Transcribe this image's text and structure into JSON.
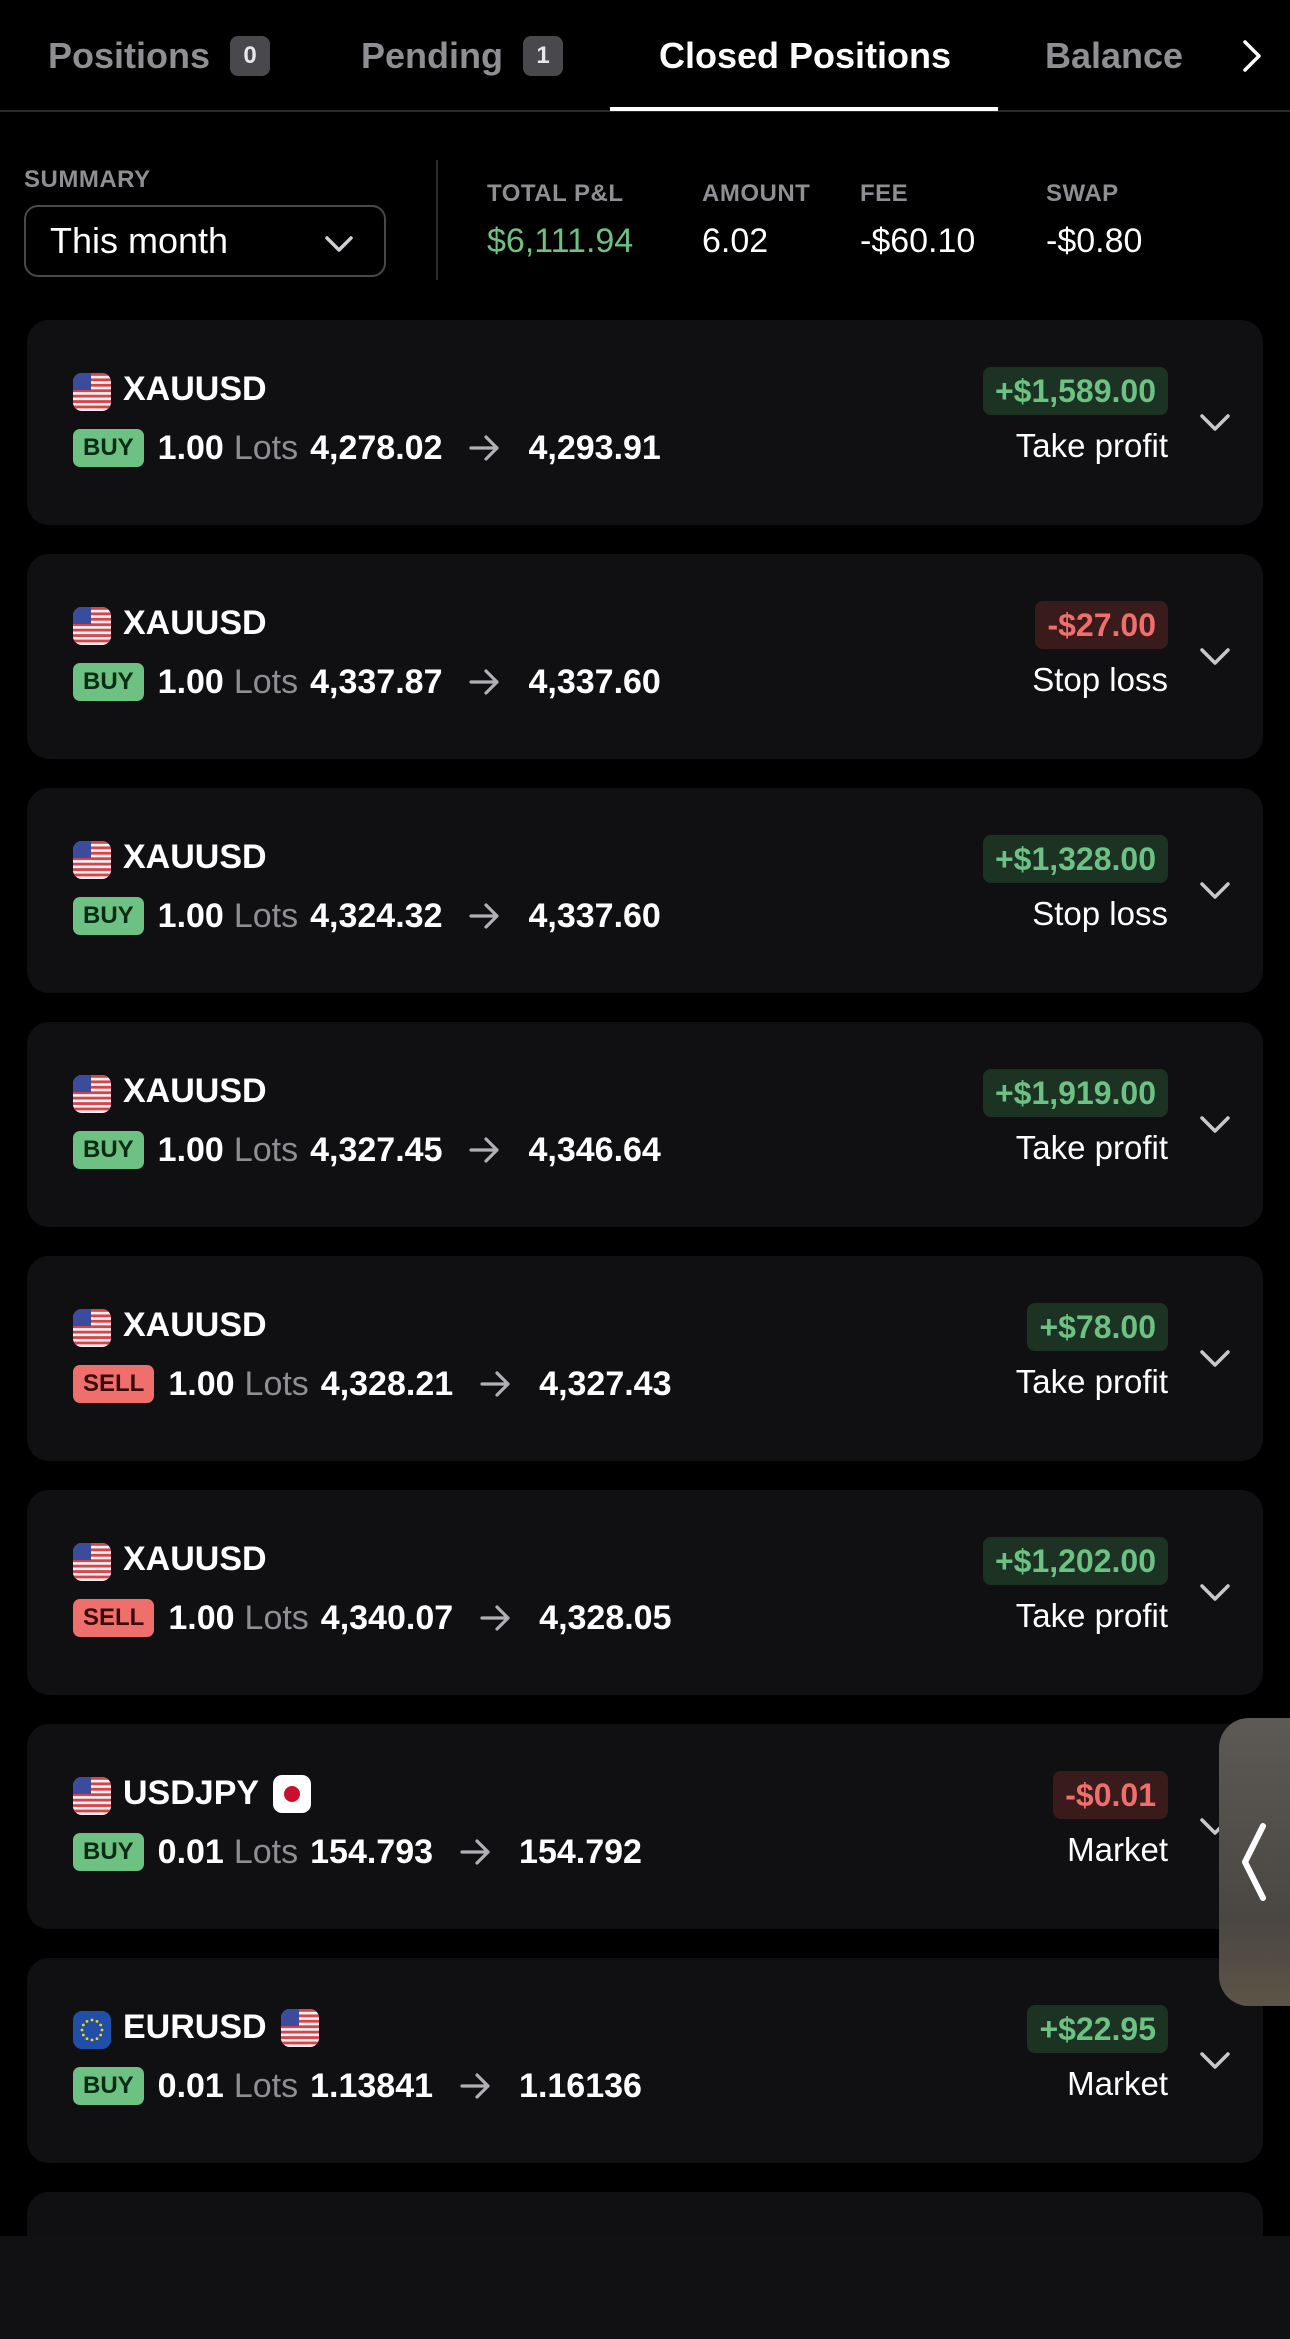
{
  "tabs": [
    {
      "label": "Positions",
      "count": "0"
    },
    {
      "label": "Pending",
      "count": "1"
    },
    {
      "label": "Closed Positions"
    },
    {
      "label": "Balance"
    }
  ],
  "summary": {
    "label": "SUMMARY",
    "period": "This month",
    "stats": [
      {
        "label": "TOTAL P&L",
        "value": "$6,111.94"
      },
      {
        "label": "AMOUNT",
        "value": "6.02"
      },
      {
        "label": "FEE",
        "value": "-$60.10"
      },
      {
        "label": "SWAP",
        "value": "-$0.80"
      }
    ]
  },
  "lots_label": "Lots",
  "colors": {
    "profit": "#6cc183",
    "loss": "#ef6f6c",
    "card": "#101013"
  },
  "positions": [
    {
      "symbol": "XAUUSD",
      "side": "BUY",
      "volume": "1.00",
      "open": "4,278.02",
      "close": "4,293.91",
      "pnl": "+$1,589.00",
      "reason": "Take profit",
      "flag": "us-flag"
    },
    {
      "symbol": "XAUUSD",
      "side": "BUY",
      "volume": "1.00",
      "open": "4,337.87",
      "close": "4,337.60",
      "pnl": "-$27.00",
      "reason": "Stop loss",
      "flag": "us-flag"
    },
    {
      "symbol": "XAUUSD",
      "side": "BUY",
      "volume": "1.00",
      "open": "4,324.32",
      "close": "4,337.60",
      "pnl": "+$1,328.00",
      "reason": "Stop loss",
      "flag": "us-flag"
    },
    {
      "symbol": "XAUUSD",
      "side": "BUY",
      "volume": "1.00",
      "open": "4,327.45",
      "close": "4,346.64",
      "pnl": "+$1,919.00",
      "reason": "Take profit",
      "flag": "us-flag"
    },
    {
      "symbol": "XAUUSD",
      "side": "SELL",
      "volume": "1.00",
      "open": "4,328.21",
      "close": "4,327.43",
      "pnl": "+$78.00",
      "reason": "Take profit",
      "flag": "us-flag"
    },
    {
      "symbol": "XAUUSD",
      "side": "SELL",
      "volume": "1.00",
      "open": "4,340.07",
      "close": "4,328.05",
      "pnl": "+$1,202.00",
      "reason": "Take profit",
      "flag": "us-flag"
    },
    {
      "symbol": "USDJPY",
      "side": "BUY",
      "volume": "0.01",
      "open": "154.793",
      "close": "154.792",
      "pnl": "-$0.01",
      "reason": "Market",
      "flag": "us-flag",
      "quote_flag": "jp-flag"
    },
    {
      "symbol": "EURUSD",
      "side": "BUY",
      "volume": "0.01",
      "open": "1.13841",
      "close": "1.16136",
      "pnl": "+$22.95",
      "reason": "Market",
      "flag": "eu-flag",
      "quote_flag": "us-flag"
    }
  ]
}
